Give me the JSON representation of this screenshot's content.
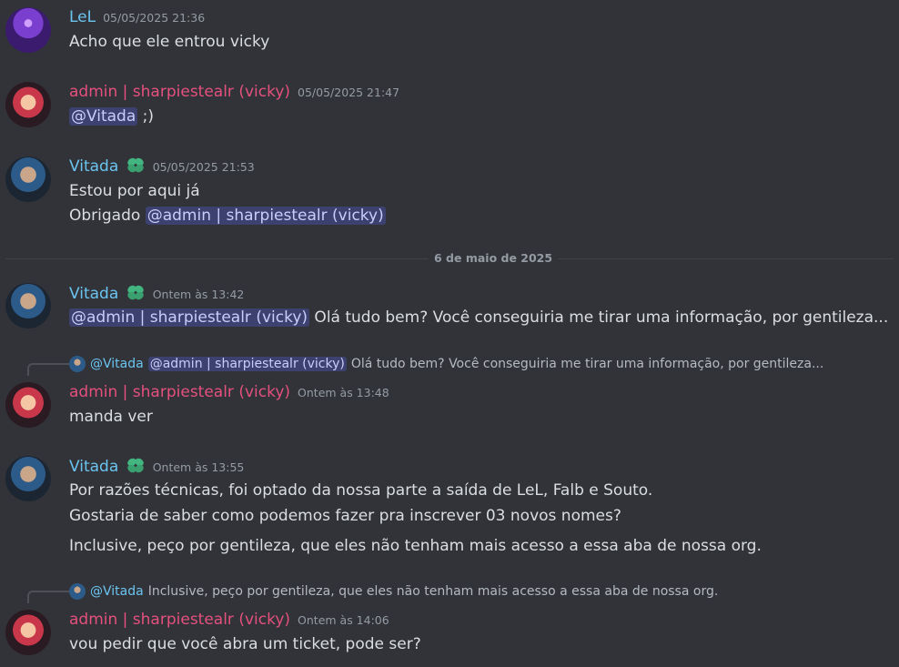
{
  "messages": [
    {
      "author": "LeL",
      "timestamp": "05/05/2025 21:36",
      "lines": [
        "Acho que ele entrou vicky"
      ]
    },
    {
      "author": "admin | sharpiestealr (vicky)",
      "timestamp": "05/05/2025 21:47",
      "mention": "@Vitada",
      "text_after": " ;)"
    },
    {
      "author": "Vitada",
      "timestamp": "05/05/2025 21:53",
      "line1": "Estou por aqui já",
      "line2_prefix": "Obrigado ",
      "line2_mention": "@admin | sharpiestealr (vicky)"
    },
    {
      "author": "Vitada",
      "timestamp": "Ontem às 13:42",
      "mention": "@admin | sharpiestealr (vicky)",
      "text_after": " Olá tudo bem? Você conseguiria me tirar uma informação, por gentileza..."
    },
    {
      "reply": {
        "name": "@Vitada",
        "mention": "@admin | sharpiestealr (vicky)",
        "text": "Olá tudo bem? Você conseguiria me tirar uma informação, por gentileza..."
      },
      "author": "admin | sharpiestealr (vicky)",
      "timestamp": "Ontem às 13:48",
      "lines": [
        "manda ver"
      ]
    },
    {
      "author": "Vitada",
      "timestamp": "Ontem às 13:55",
      "lines": [
        "Por razões técnicas, foi optado da nossa parte a saída de LeL, Falb e Souto.",
        "Gostaria de saber como podemos fazer pra inscrever 03 novos nomes?",
        "Inclusive, peço por gentileza, que eles não tenham mais acesso a essa aba de nossa org."
      ]
    },
    {
      "reply": {
        "name": "@Vitada",
        "text": "Inclusive, peço por gentileza, que eles não tenham mais acesso a essa aba de nossa org."
      },
      "author": "admin | sharpiestealr (vicky)",
      "timestamp": "Ontem às 14:06",
      "lines": [
        "vou pedir que você abra um ticket, pode ser?"
      ]
    }
  ],
  "divider": "6 de maio de 2025",
  "colors": {
    "background": "#313338",
    "name_blue": "#6bc4f0",
    "name_pink": "#e5507d",
    "mention_bg": "#3c4270",
    "badge_green": "#43b581"
  },
  "icons": {
    "badge": "leaf-badge-icon"
  }
}
